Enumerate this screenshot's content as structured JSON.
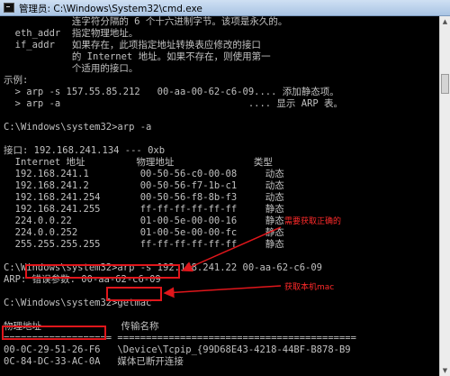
{
  "window": {
    "title": "管理员: C:\\Windows\\System32\\cmd.exe"
  },
  "console": {
    "lines": [
      "            连字符分隔的 6 个十六进制字节。该项是永久的。",
      "  eth_addr  指定物理地址。",
      "  if_addr   如果存在，此项指定地址转换表应修改的接口",
      "            的 Internet 地址。如果不存在，则使用第一",
      "            个适用的接口。",
      "示例:",
      "  > arp -s 157.55.85.212   00-aa-00-62-c6-09.... 添加静态项。",
      "  > arp -a                                 .... 显示 ARP 表。",
      "",
      "C:\\Windows\\system32>arp -a",
      "",
      "接口: 192.168.241.134 --- 0xb",
      "  Internet 地址         物理地址              类型",
      "  192.168.241.1         00-50-56-c0-00-08     动态",
      "  192.168.241.2         00-50-56-f7-1b-c1     动态",
      "  192.168.241.254       00-50-56-f8-8b-f3     动态",
      "  192.168.241.255       ff-ff-ff-ff-ff-ff     静态",
      "  224.0.0.22            01-00-5e-00-00-16     静态",
      "  224.0.0.252           01-00-5e-00-00-fc     静态",
      "  255.255.255.255       ff-ff-ff-ff-ff-ff     静态",
      "",
      "C:\\Windows\\system32>arp -s 192.168.241.22 00-aa-62-c6-09",
      "ARP: 错误参数: 00-aa-62-c6-09",
      "",
      "C:\\Windows\\system32>getmac",
      "",
      "物理地址              传输名称",
      "=================== ==========================================",
      "00-0C-29-51-26-F6   \\Device\\Tcpip_{99D68E43-4218-44BF-B878-B9",
      "0C-84-DC-33-AC-0A   媒体已断开连接",
      "",
      "C:\\Windows\\system32>"
    ]
  },
  "annotations": {
    "need_correct": "需要获取正确的",
    "get_mac": "获取本机mac"
  },
  "colors": {
    "console_text": "#c0c0c0",
    "highlight": "#e0161b",
    "annotation": "#ff2a2a"
  }
}
